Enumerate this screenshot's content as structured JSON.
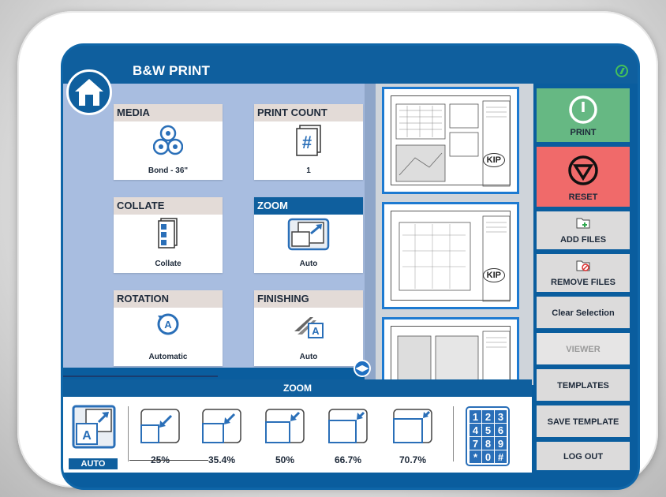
{
  "app": {
    "title": "B&W PRINT"
  },
  "settings": [
    {
      "name": "MEDIA",
      "value": "Bond - 36\""
    },
    {
      "name": "PRINT COUNT",
      "value": "1"
    },
    {
      "name": "COLLATE",
      "value": "Collate"
    },
    {
      "name": "ZOOM",
      "value": "Auto"
    },
    {
      "name": "ROTATION",
      "value": "Automatic"
    },
    {
      "name": "FINISHING",
      "value": "Auto"
    }
  ],
  "zoom": {
    "header": "ZOOM",
    "auto_label": "AUTO",
    "options": [
      "25%",
      "35.4%",
      "50%",
      "66.7%",
      "70.7%"
    ],
    "keypad": [
      "1",
      "2",
      "3",
      "4",
      "5",
      "6",
      "7",
      "8",
      "9",
      "*",
      "0",
      "#"
    ]
  },
  "actions": {
    "print": "PRINT",
    "reset": "RESET",
    "add_files": "ADD FILES",
    "remove_files": "REMOVE FILES",
    "clear_selection": "Clear Selection",
    "viewer": "VIEWER",
    "templates": "TEMPLATES",
    "save_template": "SAVE TEMPLATE",
    "log_out": "LOG OUT"
  },
  "thumbnails": [
    {
      "logo": "KIP"
    },
    {
      "logo": "KIP"
    },
    {
      "logo": ""
    }
  ],
  "colors": {
    "primary": "#0f5f9e",
    "print": "#66b883",
    "reset": "#f06a6a",
    "panel": "#a8bde0"
  }
}
